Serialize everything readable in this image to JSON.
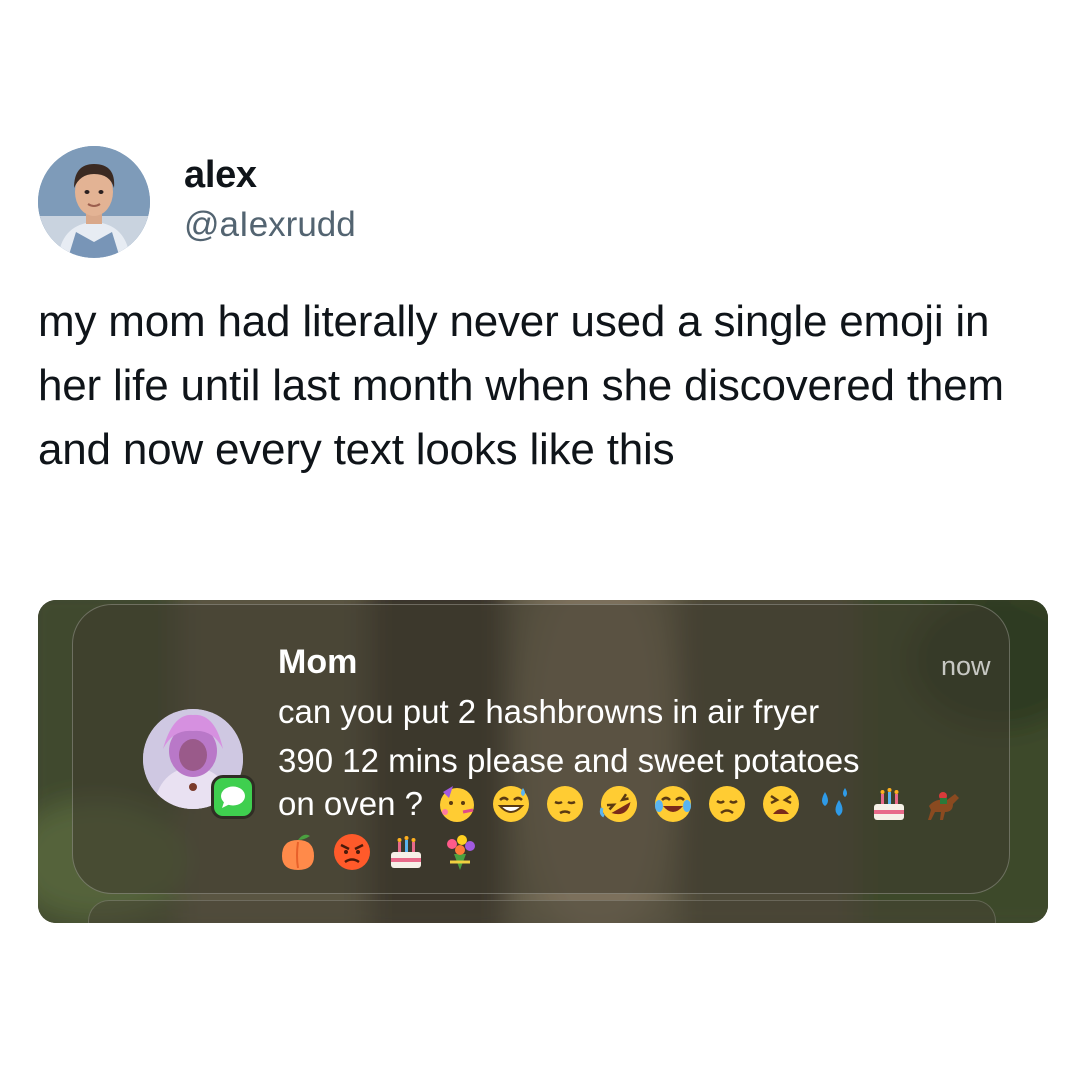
{
  "tweet": {
    "display_name": "alex",
    "handle": "@aIexrudd",
    "text": "my mom had literally never used a single emoji in her life until last month when she discovered them and now every text looks like this"
  },
  "notification": {
    "sender": "Mom",
    "timestamp": "now",
    "message_lines": [
      "can you put 2 hashbrowns in air fryer",
      "390 12 mins please and sweet potatoes"
    ],
    "message_tail": "on oven ?",
    "emojis_line_1": [
      "partying-face-icon",
      "grinning-sweat-icon",
      "pensive-face-icon",
      "rolling-laughing-icon",
      "tears-of-joy-icon",
      "disappointed-face-icon",
      "tired-face-icon",
      "sweat-droplets-icon",
      "birthday-cake-icon",
      "horse-racing-icon"
    ],
    "emojis_line_2": [
      "peach-icon",
      "angry-face-icon",
      "birthday-cake-icon",
      "bouquet-icon"
    ],
    "app_icon": "messages-icon",
    "accent_color": "#3fcf4f"
  }
}
